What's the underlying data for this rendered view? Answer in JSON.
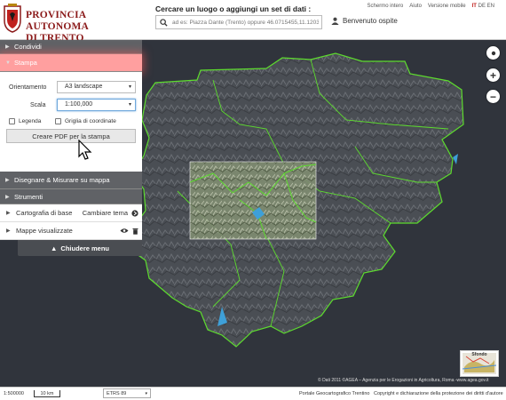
{
  "header": {
    "logo_line1": "PROVINCIA AUTONOMA",
    "logo_line2": "DI TRENTO",
    "search_label": "Cercare un luogo o aggiungi un set di dati :",
    "search_placeholder": "ad es: Piazza Dante (Trento) oppure 46.0715455,11.1203",
    "links": [
      "Schermo intero",
      "Aiuto",
      "Versione mobile"
    ],
    "languages": [
      "IT",
      "DE",
      "EN"
    ],
    "user_label": "Benvenuto ospite"
  },
  "panel": {
    "condividi": "Condividi",
    "stampa": "Stampa",
    "orientamento_label": "Orientamento",
    "orientamento_value": "A3 landscape",
    "scala_label": "Scala",
    "scala_value": "1:100,000",
    "legenda_label": "Legenda",
    "griglia_label": "Griglia di coordinate",
    "pdf_button": "Creare PDF per la stampa",
    "disegnare": "Disegnare & Misurare su mappa",
    "strumenti": "Strumenti",
    "cartografia": "Cartografia di base",
    "cambiare_tema": "Cambiare tema",
    "mappe": "Mappe visualizzate",
    "chiudere": "Chiudere menu"
  },
  "map": {
    "minimap_label": "Sfondo",
    "attribution": "© Dati 2011 ©AGEA – Agenzia per le Erogazioni in Agricoltura, Roma -www.agea.gov.it"
  },
  "footer": {
    "scale": "1:500000",
    "scalebar": "10 km",
    "crs": "ETRS 89",
    "portal": "Portale Geocartografico Trentino",
    "copyright": "Copyright e dichiarazione della protezione dei diritti d'autore"
  },
  "colors": {
    "accent_red": "#c0201e",
    "stampa_highlight": "#ff9f9f",
    "boundary_green": "#5ddc2e",
    "map_bg": "#30343c"
  },
  "icons": [
    "search-icon",
    "user-icon",
    "locate-icon",
    "zoom-in-icon",
    "zoom-out-icon",
    "eye-icon",
    "trash-icon",
    "arrow-right-icon",
    "chevron-down-icon",
    "cursor-icon"
  ]
}
